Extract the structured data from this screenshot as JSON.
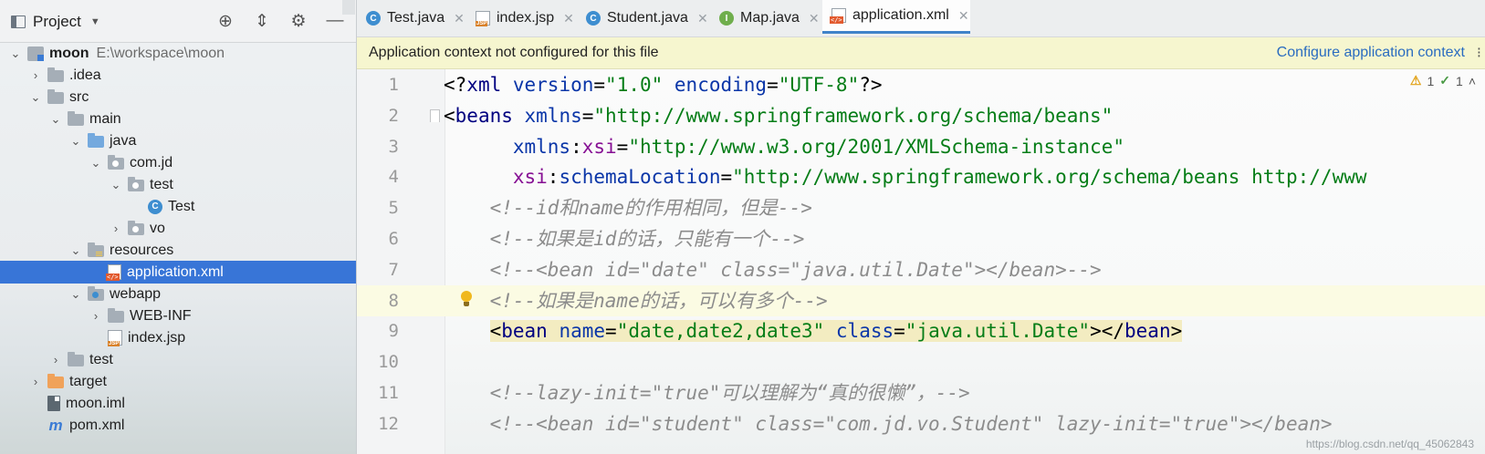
{
  "sidebar": {
    "title": "Project",
    "tools": [
      "locate-icon",
      "collapse-icon",
      "gear-icon",
      "minimize-icon"
    ],
    "tree": [
      {
        "label": "moon",
        "extra": "E:\\workspace\\moon",
        "expanded": true,
        "icon": "module"
      },
      {
        "label": ".idea",
        "expanded": false,
        "icon": "folder"
      },
      {
        "label": "src",
        "expanded": true,
        "icon": "folder"
      },
      {
        "label": "main",
        "expanded": true,
        "icon": "folder"
      },
      {
        "label": "java",
        "expanded": true,
        "icon": "source-folder"
      },
      {
        "label": "com.jd",
        "expanded": true,
        "icon": "package"
      },
      {
        "label": "test",
        "expanded": true,
        "icon": "package"
      },
      {
        "label": "Test",
        "icon": "java-class"
      },
      {
        "label": "vo",
        "expanded": false,
        "icon": "package"
      },
      {
        "label": "resources",
        "expanded": true,
        "icon": "resources-folder"
      },
      {
        "label": "application.xml",
        "icon": "xml-file",
        "selected": true
      },
      {
        "label": "webapp",
        "expanded": true,
        "icon": "web-folder"
      },
      {
        "label": "WEB-INF",
        "expanded": false,
        "icon": "folder"
      },
      {
        "label": "index.jsp",
        "icon": "jsp-file"
      },
      {
        "label": "test",
        "expanded": false,
        "icon": "folder"
      },
      {
        "label": "target",
        "expanded": false,
        "icon": "excluded-folder"
      },
      {
        "label": "moon.iml",
        "icon": "iml-file"
      },
      {
        "label": "pom.xml",
        "icon": "maven-file"
      }
    ]
  },
  "tabs": [
    {
      "label": "Test.java",
      "icon": "class-icon",
      "active": false
    },
    {
      "label": "index.jsp",
      "icon": "jsp-icon",
      "active": false
    },
    {
      "label": "Student.java",
      "icon": "class-icon",
      "active": false
    },
    {
      "label": "Map.java",
      "icon": "interface-icon",
      "active": false
    },
    {
      "label": "application.xml",
      "icon": "xml-icon",
      "active": true
    }
  ],
  "banner": {
    "message": "Application context not configured for this file",
    "link": "Configure application context"
  },
  "inspections": {
    "warnings": "1",
    "weak_warnings": "1"
  },
  "code_lines": [
    {
      "n": "1",
      "tokens": [
        [
          "pun",
          "<?"
        ],
        [
          "tag",
          "xml "
        ],
        [
          "attr",
          "version"
        ],
        [
          "pun",
          "="
        ],
        [
          "str",
          "\"1.0\" "
        ],
        [
          "attr",
          "encoding"
        ],
        [
          "pun",
          "="
        ],
        [
          "str",
          "\"UTF-8\""
        ],
        [
          "pun",
          "?>"
        ]
      ]
    },
    {
      "n": "2",
      "tokens": [
        [
          "pun",
          "<"
        ],
        [
          "tag",
          "beans "
        ],
        [
          "attr",
          "xmlns"
        ],
        [
          "pun",
          "="
        ],
        [
          "str",
          "\"http://www.springframework.org/schema/beans\""
        ]
      ]
    },
    {
      "n": "3",
      "tokens": [
        [
          "pun",
          "      "
        ],
        [
          "attr",
          "xmlns"
        ],
        [
          "pun",
          ":"
        ],
        [
          "ns",
          "xsi"
        ],
        [
          "pun",
          "="
        ],
        [
          "str",
          "\"http://www.w3.org/2001/XMLSchema-instance\""
        ]
      ]
    },
    {
      "n": "4",
      "tokens": [
        [
          "pun",
          "      "
        ],
        [
          "ns",
          "xsi"
        ],
        [
          "pun",
          ":"
        ],
        [
          "attr",
          "schemaLocation"
        ],
        [
          "pun",
          "="
        ],
        [
          "str",
          "\"http://www.springframework.org/schema/beans http://www"
        ]
      ]
    },
    {
      "n": "5",
      "tokens": [
        [
          "cmt",
          "    <!--id和name的作用相同，但是-->"
        ]
      ]
    },
    {
      "n": "6",
      "tokens": [
        [
          "cmt",
          "    <!--如果是id的话，只能有一个-->"
        ]
      ]
    },
    {
      "n": "7",
      "tokens": [
        [
          "cmt",
          "    <!--<bean id=\"date\" class=\"java.util.Date\"></bean>-->"
        ]
      ]
    },
    {
      "n": "8",
      "tokens": [
        [
          "cmt",
          "    <!--如果是name的话，可以有多个-->"
        ]
      ]
    },
    {
      "n": "9",
      "tokens": [
        [
          "pun",
          "    "
        ],
        [
          "hl:pun",
          "<"
        ],
        [
          "hl:tag",
          "bean "
        ],
        [
          "hl:attr",
          "name"
        ],
        [
          "hl:pun",
          "="
        ],
        [
          "hl:str",
          "\"date,date2,date3\" "
        ],
        [
          "hl:attr",
          "class"
        ],
        [
          "hl:pun",
          "="
        ],
        [
          "hl:str",
          "\"java.util.Date\""
        ],
        [
          "hl:pun",
          "></"
        ],
        [
          "hl:tag",
          "bean"
        ],
        [
          "hl:pun",
          ">"
        ]
      ]
    },
    {
      "n": "10",
      "tokens": []
    },
    {
      "n": "11",
      "tokens": [
        [
          "cmt",
          "    <!--lazy-init=\"true\"可以理解为“真的很懒”，-->"
        ]
      ]
    },
    {
      "n": "12",
      "tokens": [
        [
          "cmt",
          "    <!--<bean id=\"student\" class=\"com.jd.vo.Student\" lazy-init=\"true\"></bean>"
        ]
      ]
    }
  ],
  "watermark": "https://blog.csdn.net/qq_45062843"
}
